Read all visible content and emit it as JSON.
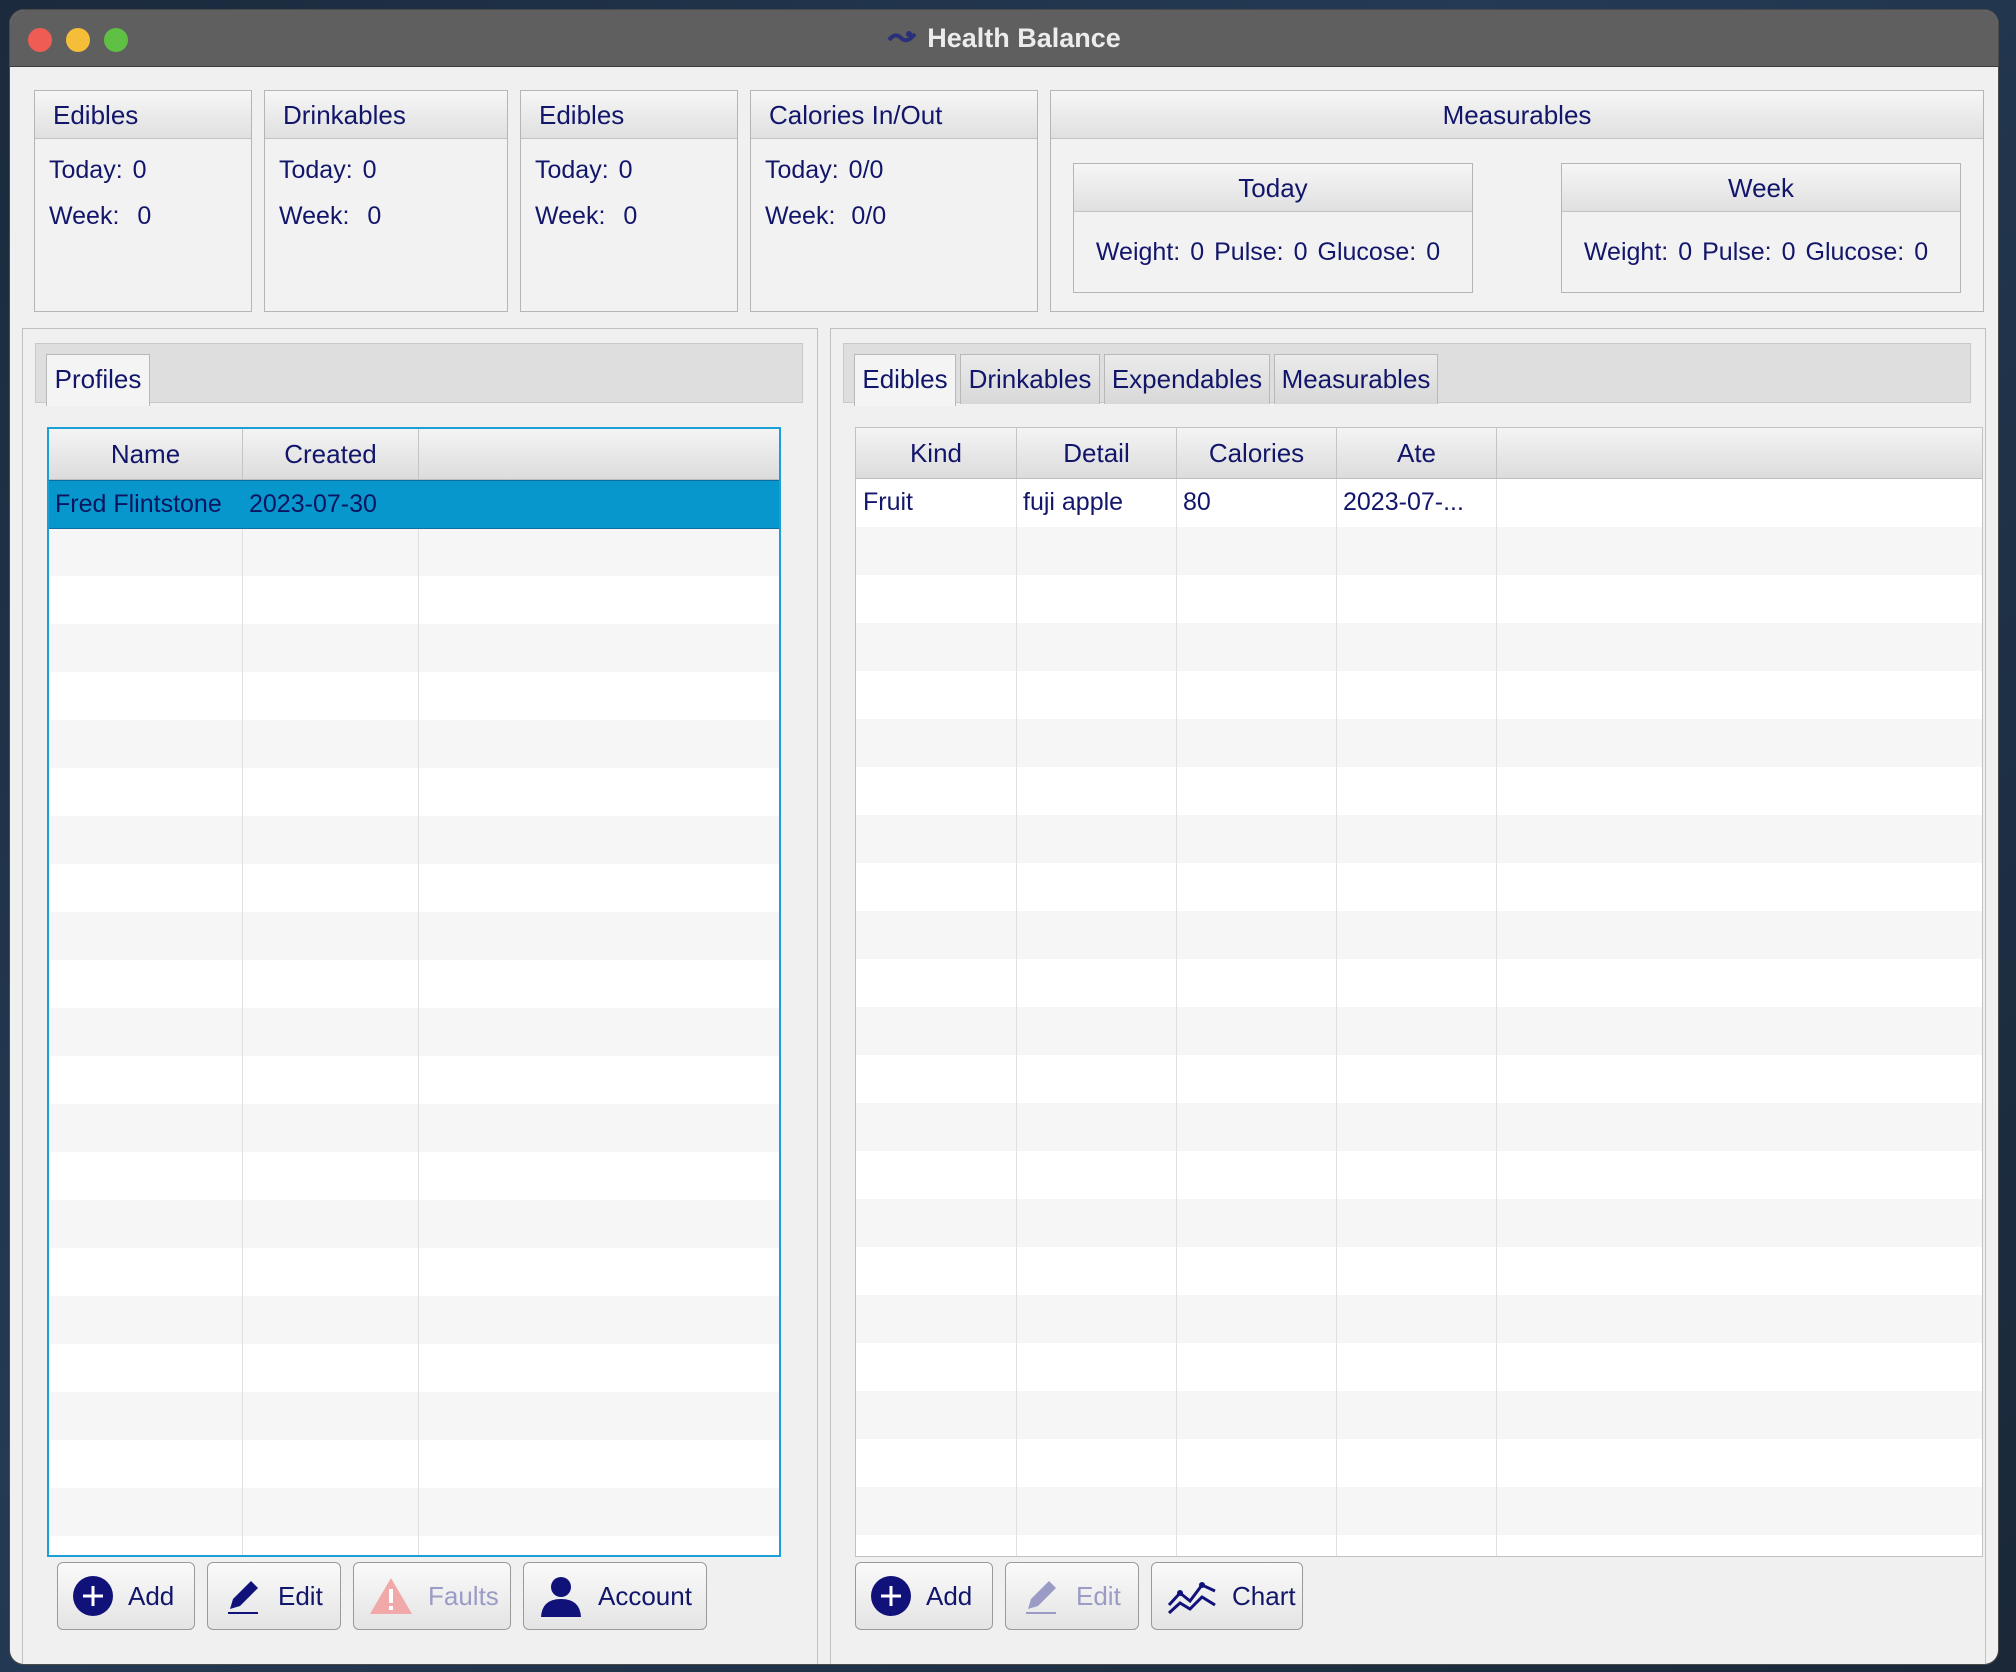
{
  "window": {
    "title": "Health Balance"
  },
  "summary": {
    "edibles1": {
      "label": "Edibles",
      "today_label": "Today:",
      "today": "0",
      "week_label": "Week:",
      "week": "0"
    },
    "drinkables": {
      "label": "Drinkables",
      "today_label": "Today:",
      "today": "0",
      "week_label": "Week:",
      "week": "0"
    },
    "edibles2": {
      "label": "Edibles",
      "today_label": "Today:",
      "today": "0",
      "week_label": "Week:",
      "week": "0"
    },
    "calories": {
      "label": "Calories In/Out",
      "today_label": "Today:",
      "today": "0/0",
      "week_label": "Week:",
      "week": "0/0"
    },
    "measurables": {
      "label": "Measurables",
      "today": {
        "label": "Today",
        "weight_label": "Weight:",
        "weight": "0",
        "pulse_label": "Pulse:",
        "pulse": "0",
        "glucose_label": "Glucose:",
        "glucose": "0"
      },
      "week": {
        "label": "Week",
        "weight_label": "Weight:",
        "weight": "0",
        "pulse_label": "Pulse:",
        "pulse": "0",
        "glucose_label": "Glucose:",
        "glucose": "0"
      }
    }
  },
  "profiles": {
    "tab": "Profiles",
    "columns": [
      "Name",
      "Created"
    ],
    "rows": [
      {
        "name": "Fred Flintstone",
        "created": "2023-07-30"
      }
    ],
    "buttons": {
      "add": "Add",
      "edit": "Edit",
      "faults": "Faults",
      "account": "Account"
    }
  },
  "detail": {
    "tabs": [
      "Edibles",
      "Drinkables",
      "Expendables",
      "Measurables"
    ],
    "columns": [
      "Kind",
      "Detail",
      "Calories",
      "Ate"
    ],
    "rows": [
      {
        "kind": "Fruit",
        "detail": "fuji apple",
        "calories": "80",
        "ate": "2023-07-..."
      }
    ],
    "buttons": {
      "add": "Add",
      "edit": "Edit",
      "chart": "Chart"
    }
  },
  "colors": {
    "accent": "#0897cc",
    "text": "#12166a",
    "button_icon": "#10127a"
  }
}
